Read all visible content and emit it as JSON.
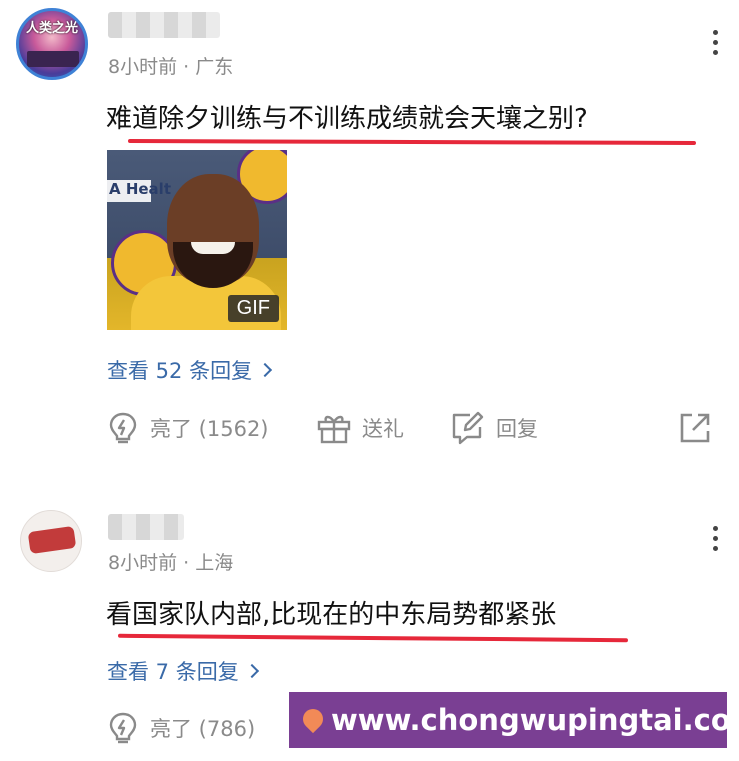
{
  "comments": [
    {
      "time": "8小时前",
      "location": "广东",
      "text": "难道除夕训练与不训练成绩就会天壤之别?",
      "avatar_text": "人类之光",
      "gif_label": "GIF",
      "gif_banner": "A Healt",
      "replies_label": "查看 52 条回复",
      "like_label": "亮了 (1562)",
      "gift_label": "送礼",
      "reply_label": "回复"
    },
    {
      "time": "8小时前",
      "location": "上海",
      "text": "看国家队内部,比现在的中东局势都紧张",
      "replies_label": "查看 7 条回复",
      "like_label": "亮了 (786)"
    }
  ],
  "meta_separator": " · ",
  "watermark": "www.chongwupingtai.com",
  "colors": {
    "underline": "#e6283a",
    "link": "#3a6aa8",
    "watermark_bg": "#7a3f93"
  },
  "icons": [
    "lightbulb-icon",
    "gift-icon",
    "edit-reply-icon",
    "share-icon",
    "more-vertical-icon",
    "chevron-right-icon",
    "location-pin-icon"
  ]
}
